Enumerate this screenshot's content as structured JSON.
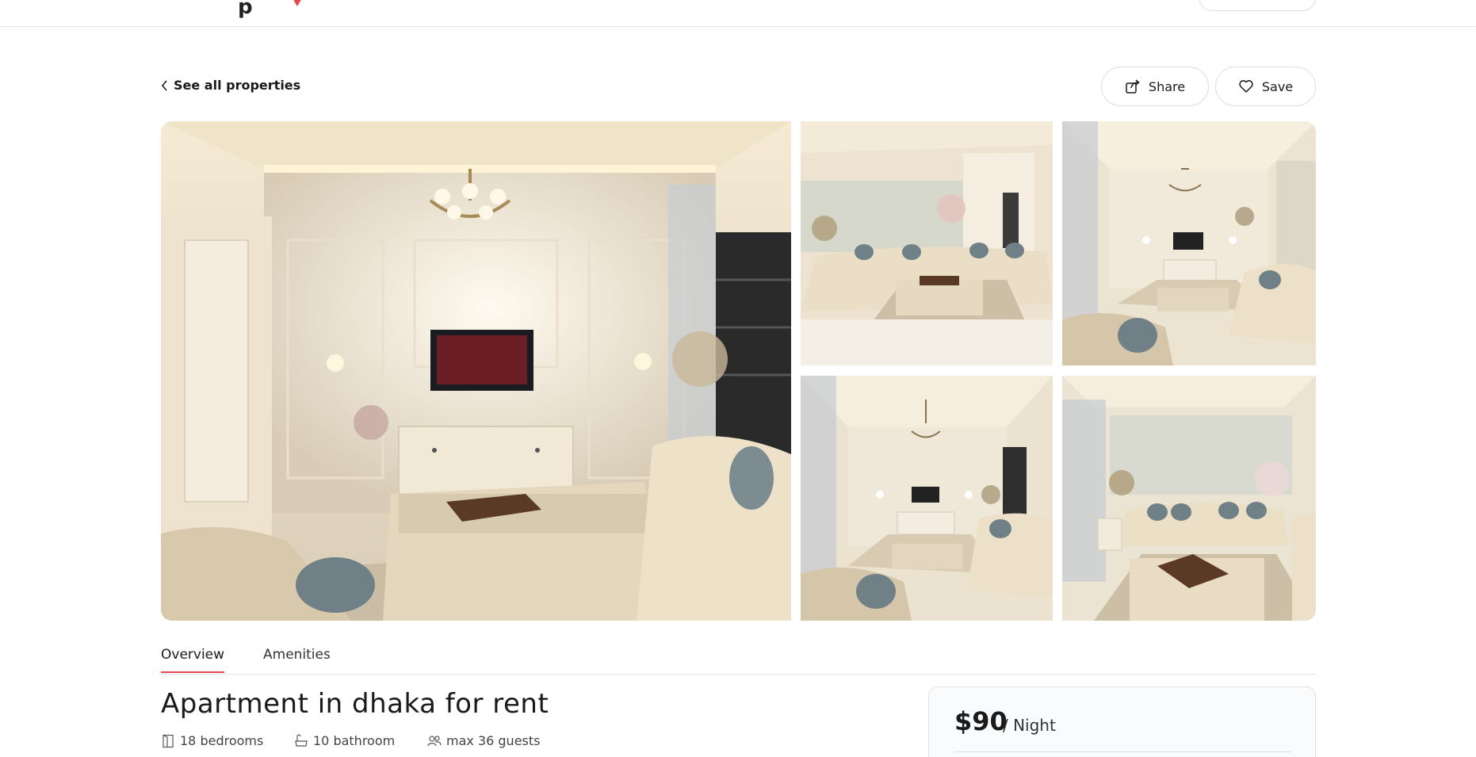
{
  "header": {
    "logo_fragment": "p"
  },
  "navigation": {
    "back_label": "See all properties"
  },
  "actions": {
    "share_label": "Share",
    "save_label": "Save"
  },
  "gallery": {
    "photos": [
      {
        "id": "main",
        "alt": "Living room with chandelier, TV and tufted ottoman"
      },
      {
        "id": "2",
        "alt": "Living room with sofas and floral wallpaper"
      },
      {
        "id": "3",
        "alt": "Living room view toward TV and chandelier"
      },
      {
        "id": "4",
        "alt": "Living room wide view with chandelier"
      },
      {
        "id": "5",
        "alt": "Sofa set with ottoman and tray"
      }
    ]
  },
  "tabs": [
    {
      "label": "Overview",
      "active": true
    },
    {
      "label": "Amenities",
      "active": false
    }
  ],
  "listing": {
    "title": "Apartment in dhaka for rent",
    "bedrooms": "18 bedrooms",
    "bathrooms": "10 bathroom",
    "guests": "max 36 guests"
  },
  "pricing": {
    "amount": "$90",
    "unit": "/ Night"
  },
  "colors": {
    "accent": "#e5484d",
    "border": "#e3e3e3",
    "text": "#1a1a1a"
  },
  "icons": [
    "chevron-left-icon",
    "share-icon",
    "heart-icon",
    "bed-icon",
    "bath-icon",
    "guests-icon",
    "location-pin-icon"
  ]
}
